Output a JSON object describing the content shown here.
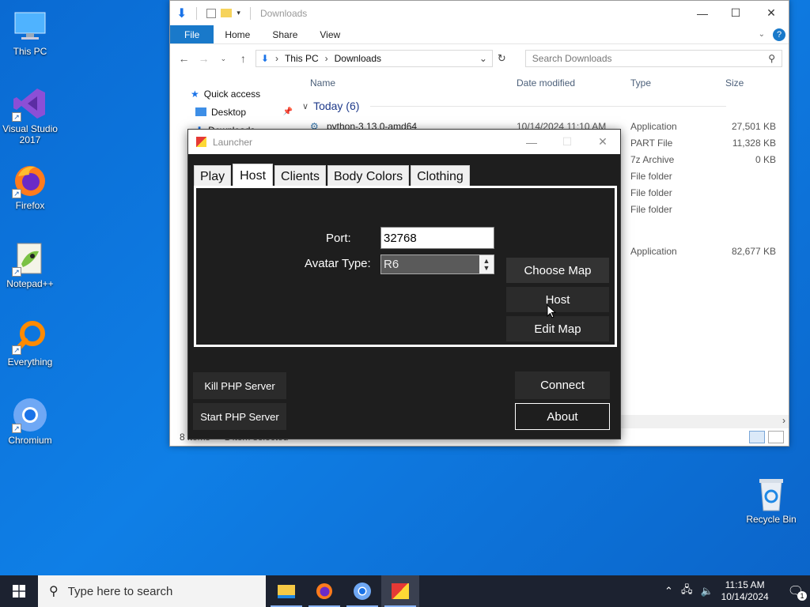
{
  "desktop": {
    "icons": [
      {
        "label": "This PC"
      },
      {
        "label": "Visual Studio 2017"
      },
      {
        "label": "Firefox"
      },
      {
        "label": "Notepad++"
      },
      {
        "label": "Everything"
      },
      {
        "label": "Chromium"
      },
      {
        "label": "Recycle Bin"
      }
    ]
  },
  "explorer": {
    "title": "Downloads",
    "ribbon": {
      "file": "File",
      "home": "Home",
      "share": "Share",
      "view": "View"
    },
    "address": {
      "this_pc": "This PC",
      "downloads": "Downloads"
    },
    "search_placeholder": "Search Downloads",
    "columns": {
      "name": "Name",
      "date": "Date modified",
      "type": "Type",
      "size": "Size"
    },
    "sidebar": {
      "quick_access": "Quick access",
      "desktop": "Desktop",
      "downloads": "Downloads"
    },
    "group": "Today (6)",
    "rows": [
      {
        "name": "python-3.13.0-amd64",
        "date": "10/14/2024 11:10 AM",
        "type": "Application",
        "size": "27,501 KB"
      },
      {
        "name": "",
        "date": "",
        "type": "PART File",
        "size": "11,328 KB"
      },
      {
        "name": "",
        "date": "",
        "type": "7z Archive",
        "size": "0 KB"
      },
      {
        "name": "",
        "date": "",
        "type": "File folder",
        "size": ""
      },
      {
        "name": "",
        "date": "",
        "type": "File folder",
        "size": ""
      },
      {
        "name": "",
        "date": "",
        "type": "File folder",
        "size": ""
      },
      {
        "name": "",
        "date": "",
        "type": "Application",
        "size": "82,677 KB"
      }
    ],
    "status": {
      "items": "8 items",
      "selected": "1 item selected"
    }
  },
  "launcher": {
    "title": "Launcher",
    "tabs": [
      "Play",
      "Host",
      "Clients",
      "Body Colors",
      "Clothing"
    ],
    "port_label": "Port:",
    "port_value": "32768",
    "avatar_label": "Avatar Type:",
    "avatar_value": "R6",
    "choose_map": "Choose Map",
    "host": "Host",
    "edit_map": "Edit Map",
    "kill_php": "Kill PHP Server",
    "start_php": "Start PHP Server",
    "connect": "Connect",
    "about": "About"
  },
  "taskbar": {
    "search_placeholder": "Type here to search",
    "time": "11:15 AM",
    "date": "10/14/2024",
    "notification_count": "1"
  },
  "colors": {
    "desktop_bg": "#0b6fd6",
    "explorer_accent": "#1979ca",
    "launcher_bg": "#1e1e1e",
    "taskbar_bg": "#1c2230"
  }
}
